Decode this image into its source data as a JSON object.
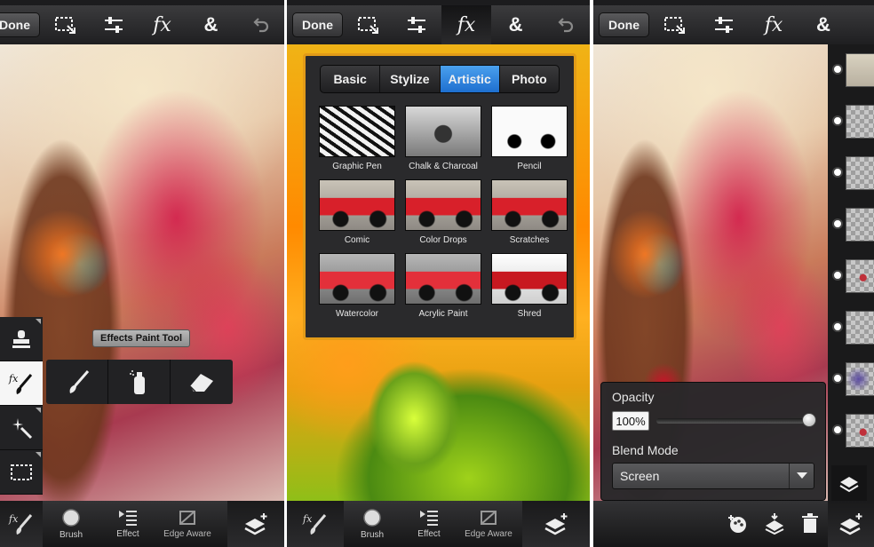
{
  "toolbar": {
    "done_label": "Done",
    "fx_glyph": "fx",
    "amp_glyph": "&"
  },
  "panel1": {
    "tooltip": "Effects Paint Tool",
    "bottom": {
      "brush_label": "Brush",
      "effect_label": "Effect",
      "edge_label": "Edge Aware"
    },
    "fx_small": "fx"
  },
  "panel2": {
    "tabs": [
      "Basic",
      "Stylize",
      "Artistic",
      "Photo"
    ],
    "active_tab": "Artistic",
    "filters": [
      "Graphic Pen",
      "Chalk & Charcoal",
      "Pencil",
      "Comic",
      "Color Drops",
      "Scratches",
      "Watercolor",
      "Acrylic Paint",
      "Shred"
    ],
    "bottom": {
      "brush_label": "Brush",
      "effect_label": "Effect",
      "edge_label": "Edge Aware"
    },
    "fx_small": "fx"
  },
  "panel3": {
    "opacity_label": "Opacity",
    "opacity_value": "100%",
    "blend_label": "Blend Mode",
    "blend_value": "Screen"
  },
  "colors": {
    "accent_orange": "#e29b18",
    "active_blue": "#1e6fcf"
  }
}
